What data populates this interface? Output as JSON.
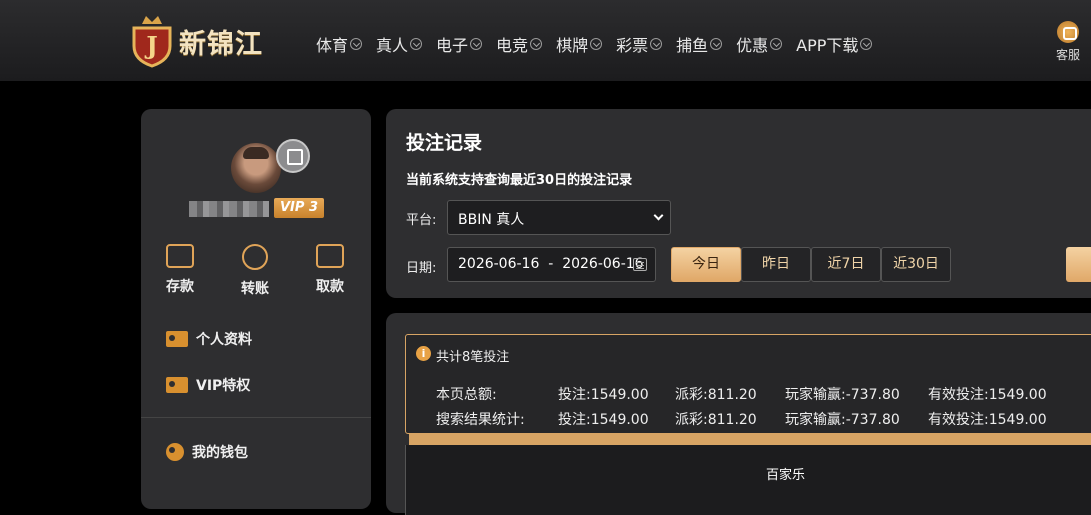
{
  "header": {
    "logo_text": "新锦江",
    "nav": [
      {
        "label": "体育"
      },
      {
        "label": "真人"
      },
      {
        "label": "电子"
      },
      {
        "label": "电竞"
      },
      {
        "label": "棋牌"
      },
      {
        "label": "彩票"
      },
      {
        "label": "捕鱼"
      },
      {
        "label": "优惠"
      },
      {
        "label": "APP下载"
      }
    ],
    "service_label": "客服"
  },
  "sidebar": {
    "vip_label": "VIP 3",
    "quick_actions": [
      {
        "label": "存款",
        "icon": "wallet-icon"
      },
      {
        "label": "转账",
        "icon": "transfer-icon"
      },
      {
        "label": "取款",
        "icon": "card-icon"
      }
    ],
    "menu": [
      {
        "label": "个人资料",
        "icon": "id-card-icon"
      },
      {
        "label": "VIP特权",
        "icon": "id-card-icon"
      },
      {
        "label": "我的钱包",
        "icon": "wallet-icon"
      }
    ]
  },
  "main": {
    "title": "投注记录",
    "note": "当前系统支持查询最近30日的投注记录",
    "platform_label": "平台:",
    "platform_value": "BBIN 真人",
    "date_label": "日期:",
    "date_range": "2026-06-16  -  2026-06-16",
    "range_buttons": [
      {
        "label": "今日",
        "active": true
      },
      {
        "label": "昨日",
        "active": false
      },
      {
        "label": "近7日",
        "active": false
      },
      {
        "label": "近30日",
        "active": false
      }
    ]
  },
  "results": {
    "count_text": "共计8笔投注",
    "rows": [
      {
        "label": "本页总额:",
        "bet": "投注:1549.00",
        "payout": "派彩:811.20",
        "winloss": "玩家输赢:-737.80",
        "valid": "有效投注:1549.00"
      },
      {
        "label": "搜索结果统计:",
        "bet": "投注:1549.00",
        "payout": "派彩:811.20",
        "winloss": "玩家输赢:-737.80",
        "valid": "有效投注:1549.00"
      }
    ],
    "table_header": "百家乐"
  },
  "colors": {
    "accent": "#e0a868",
    "panel": "#2e2e30",
    "background": "#000000"
  }
}
